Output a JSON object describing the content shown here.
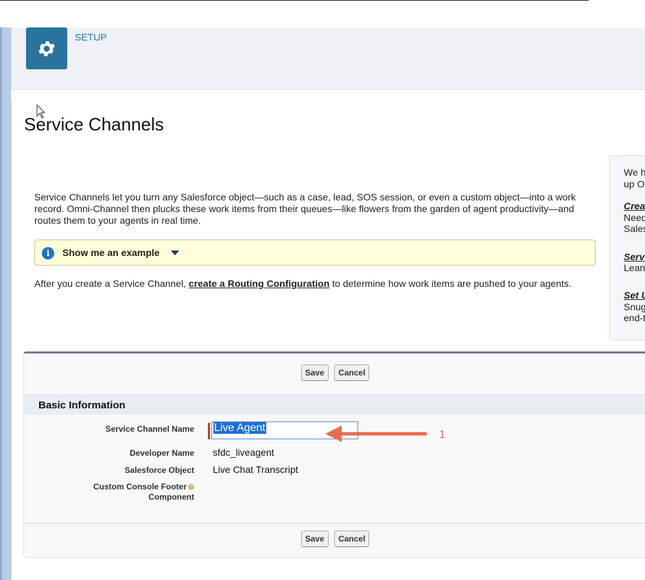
{
  "header": {
    "section_label": "SETUP",
    "icon": "gear-icon"
  },
  "page": {
    "title": "Service Channels",
    "intro": "Service Channels let you turn any Salesforce object—such as a case, lead, SOS session, or even a custom object—into a work record. Omni-Channel then plucks these work items from their queues—like flowers from the garden of agent productivity—and routes them to your agents in real time.",
    "example_label": "Show me an example",
    "after_prefix": "After you create a Service Channel, ",
    "after_link": "create a Routing Configuration",
    "after_suffix": " to determine how work items are pushed to your agents."
  },
  "right_panel": {
    "line1": "We h",
    "line2": "up O",
    "h1": "Crea",
    "h1_l1": "Need",
    "h1_l2": "Sales",
    "h2": "Serv",
    "h2_l1": "Learn",
    "h3": "Set U",
    "h3_l1": "Snug",
    "h3_l2": "end-t"
  },
  "form": {
    "save_label": "Save",
    "cancel_label": "Cancel",
    "section_title": "Basic Information",
    "fields": {
      "name_label": "Service Channel Name",
      "name_value": "Live Agent",
      "dev_label": "Developer Name",
      "dev_value": "sfdc_liveagent",
      "obj_label": "Salesforce Object",
      "obj_value": "Live Chat Transcript",
      "footer_label_1": "Custom Console Footer",
      "footer_label_2": "Component"
    }
  },
  "annotation": {
    "number": "1",
    "color": "#e76d4f"
  },
  "colors": {
    "brand": "#2a739e",
    "link": "#2a73b0",
    "required": "#c23934",
    "selection": "#1e6fd1"
  }
}
